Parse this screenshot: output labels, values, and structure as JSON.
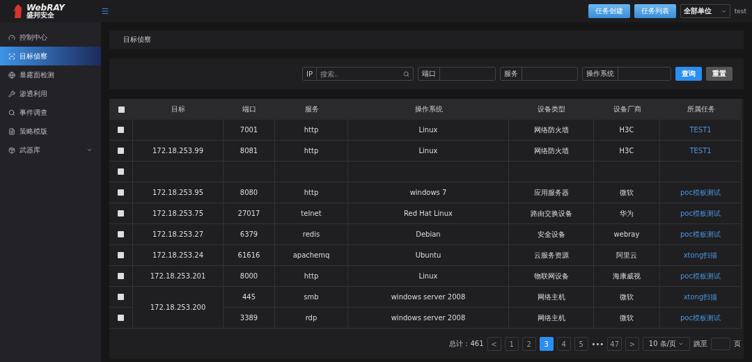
{
  "header": {
    "logo_text": "WebRAY",
    "logo_subtext": "盛邦安全",
    "buttons": [
      "任务创建",
      "任务列表"
    ],
    "unit_select": {
      "value": "全部单位"
    },
    "user": "test"
  },
  "sidebar": {
    "items": [
      {
        "label": "控制中心",
        "selected": false,
        "expandable": false
      },
      {
        "label": "目标侦察",
        "selected": true,
        "expandable": false
      },
      {
        "label": "暴露面检测",
        "selected": false,
        "expandable": false
      },
      {
        "label": "渗透利用",
        "selected": false,
        "expandable": false
      },
      {
        "label": "事件调查",
        "selected": false,
        "expandable": false
      },
      {
        "label": "策略模版",
        "selected": false,
        "expandable": false
      },
      {
        "label": "武器库",
        "selected": false,
        "expandable": true
      }
    ]
  },
  "breadcrumb": "目标侦察",
  "filters": [
    {
      "label": "IP",
      "placeholder": "搜索..",
      "search": true
    },
    {
      "label": "端口"
    },
    {
      "label": "服务"
    },
    {
      "label": "操作系统"
    }
  ],
  "filter_buttons": [
    {
      "label": "查询",
      "kind": "primary"
    },
    {
      "label": "重置",
      "kind": "secondary"
    }
  ],
  "table": {
    "select_all": {
      "checked": false
    },
    "columns": [
      "目标",
      "端口",
      "服务",
      "操作系统",
      "设备类型",
      "设备厂商",
      "所属任务"
    ],
    "groups": [
      {
        "rows": [
          {
            "checked": false,
            "port": "7001",
            "service": "http",
            "os": "Linux",
            "device_type": "网络防火墙",
            "vendor": "H3C",
            "task": "TEST1"
          }
        ]
      },
      {
        "target": "172.18.253.99",
        "rows": [
          {
            "checked": false,
            "port": "8081",
            "service": "http",
            "os": "Linux",
            "device_type": "网络防火墙",
            "vendor": "H3C",
            "task": "TEST1"
          }
        ]
      },
      {
        "rows": [
          {
            "checked": false
          }
        ]
      },
      {
        "target": "172.18.253.95",
        "rows": [
          {
            "checked": false,
            "port": "8080",
            "service": "http",
            "os": "windows 7",
            "device_type": "应用服务器",
            "vendor": "微软",
            "task": "poc模板测试"
          }
        ]
      },
      {
        "target": "172.18.253.75",
        "rows": [
          {
            "checked": false,
            "port": "27017",
            "service": "telnet",
            "os": "Red Hat Linux",
            "device_type": "路由交换设备",
            "vendor": "华为",
            "task": "poc模板测试"
          }
        ]
      },
      {
        "target": "172.18.253.27",
        "rows": [
          {
            "checked": false,
            "port": "6379",
            "service": "redis",
            "os": "Debian",
            "device_type": "安全设备",
            "vendor": "webray",
            "task": "poc模板测试"
          }
        ]
      },
      {
        "target": "172.18.253.24",
        "rows": [
          {
            "checked": false,
            "port": "61616",
            "service": "apachemq",
            "os": "Ubuntu",
            "device_type": "云服务资源",
            "vendor": "阿里云",
            "task": "xtong扫描"
          }
        ]
      },
      {
        "target": "172.18.253.201",
        "rows": [
          {
            "checked": false,
            "port": "8000",
            "service": "http",
            "os": "Linux",
            "device_type": "物联网设备",
            "vendor": "海康威视",
            "task": "poc模板测试"
          }
        ]
      },
      {
        "target": "172.18.253.200",
        "rows": [
          {
            "checked": false,
            "port": "445",
            "service": "smb",
            "os": "windows server 2008",
            "device_type": "网络主机",
            "vendor": "微软",
            "task": "xtong扫描"
          },
          {
            "checked": false,
            "port": "3389",
            "service": "rdp",
            "os": "windows server 2008",
            "device_type": "网络主机",
            "vendor": "微软",
            "task": "poc模板测试"
          }
        ]
      }
    ]
  },
  "pagination": {
    "total": "总计：461",
    "prev": "<",
    "next": ">",
    "pages": [
      {
        "label": "1",
        "selected": false
      },
      {
        "label": "2",
        "selected": false
      },
      {
        "label": "3",
        "selected": true
      },
      {
        "label": "4",
        "selected": false
      },
      {
        "label": "5",
        "selected": false
      },
      {
        "label": "•••",
        "kind": "ellipsis",
        "selected": false
      },
      {
        "label": "47",
        "selected": false
      }
    ],
    "page_size": "10 条/页",
    "jump_label": "跳至",
    "page_unit": "页"
  }
}
